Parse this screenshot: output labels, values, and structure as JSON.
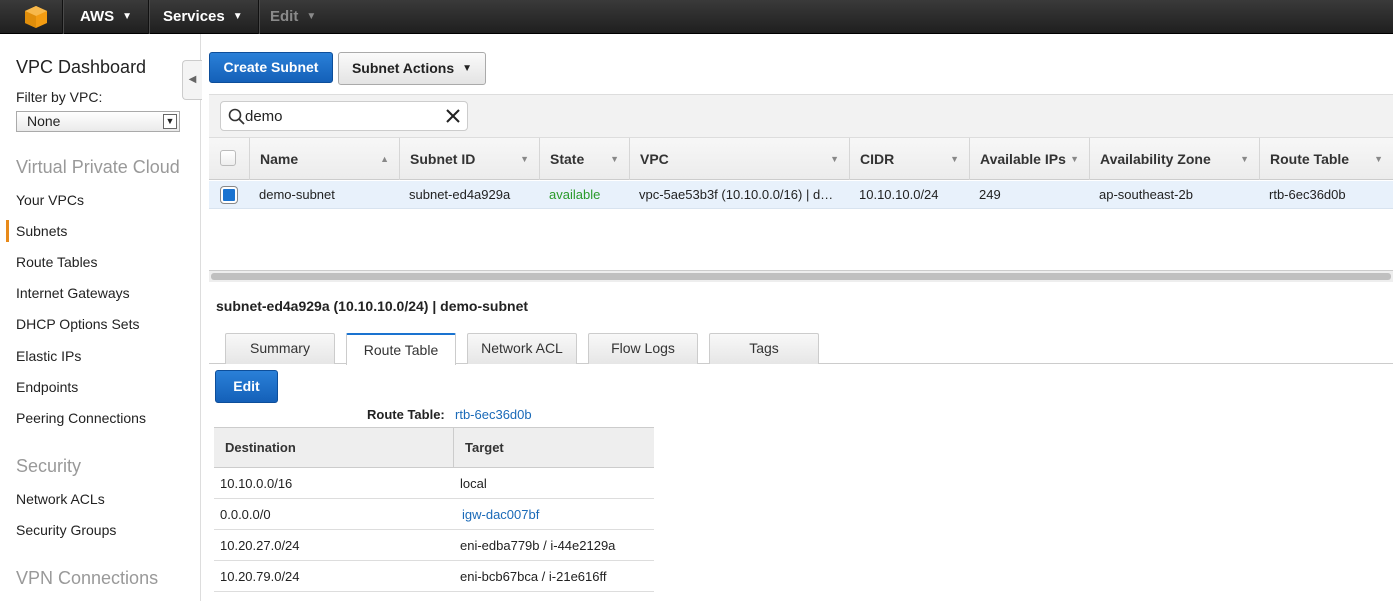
{
  "topbar": {
    "brand": "AWS",
    "services": "Services",
    "edit": "Edit"
  },
  "sidebar": {
    "title": "VPC Dashboard",
    "filter_label": "Filter by VPC:",
    "filter_value": "None",
    "sections": [
      {
        "title": "Virtual Private Cloud",
        "items": [
          "Your VPCs",
          "Subnets",
          "Route Tables",
          "Internet Gateways",
          "DHCP Options Sets",
          "Elastic IPs",
          "Endpoints",
          "Peering Connections"
        ]
      },
      {
        "title": "Security",
        "items": [
          "Network ACLs",
          "Security Groups"
        ]
      },
      {
        "title": "VPN Connections",
        "items": []
      }
    ],
    "active_item": "Subnets"
  },
  "toolbar": {
    "create_label": "Create Subnet",
    "actions_label": "Subnet Actions"
  },
  "search": {
    "value": "demo"
  },
  "grid": {
    "columns": [
      "Name",
      "Subnet ID",
      "State",
      "VPC",
      "CIDR",
      "Available IPs",
      "Availability Zone",
      "Route Table"
    ],
    "row": {
      "name": "demo-subnet",
      "subnet_id": "subnet-ed4a929a",
      "state": "available",
      "vpc": "vpc-5ae53b3f (10.10.0.0/16) | d…",
      "cidr": "10.10.10.0/24",
      "available_ips": "249",
      "az": "ap-southeast-2b",
      "route_table": "rtb-6ec36d0b"
    }
  },
  "detail": {
    "title": "subnet-ed4a929a (10.10.10.0/24) | demo-subnet",
    "tabs": [
      "Summary",
      "Route Table",
      "Network ACL",
      "Flow Logs",
      "Tags"
    ],
    "active_tab": "Route Table",
    "edit_label": "Edit",
    "route_table_label": "Route Table:",
    "route_table_value": "rtb-6ec36d0b",
    "routes_header": {
      "destination": "Destination",
      "target": "Target"
    },
    "routes": [
      {
        "destination": "10.10.0.0/16",
        "target": "local"
      },
      {
        "destination": "0.0.0.0/0",
        "target": "igw-dac007bf"
      },
      {
        "destination": "10.20.27.0/24",
        "target": "eni-edba779b / i-44e2129a"
      },
      {
        "destination": "10.20.79.0/24",
        "target": "eni-bcb67bca / i-21e616ff"
      }
    ]
  },
  "colors": {
    "accent": "#1a73d0",
    "state_available": "#2a9a2a",
    "link": "#1a6ab8",
    "active_marker": "#e88a1a"
  }
}
